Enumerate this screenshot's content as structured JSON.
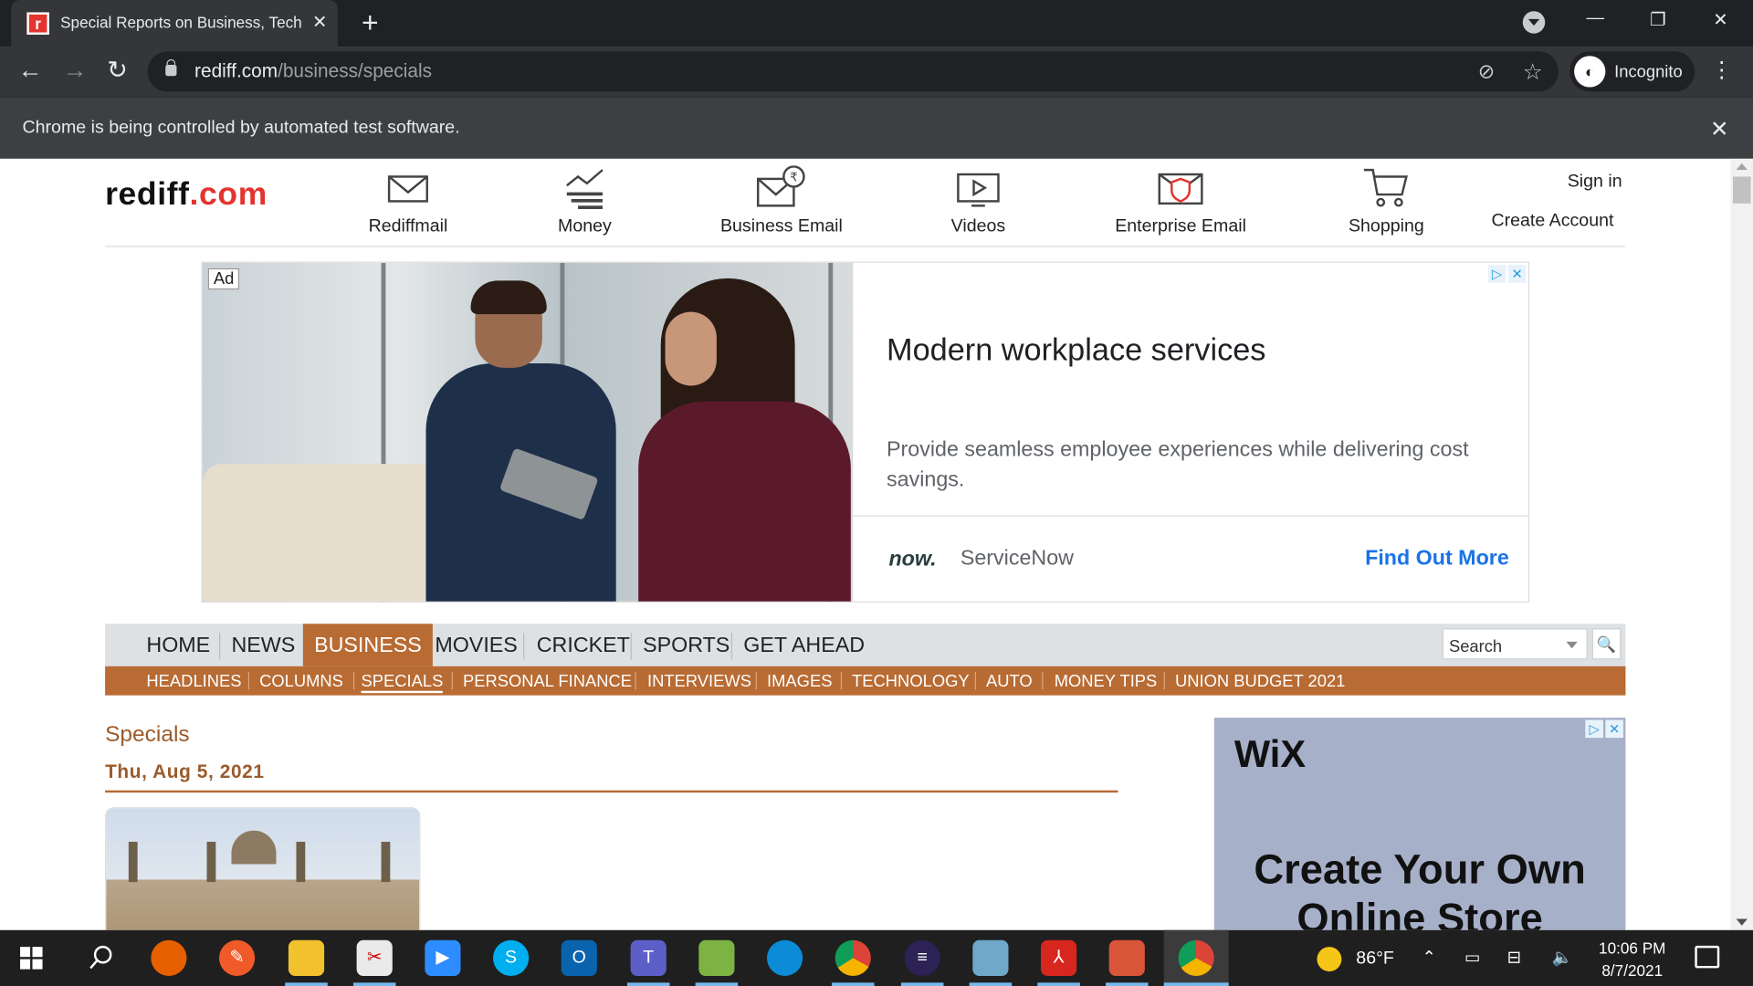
{
  "browser": {
    "tab_title": "Special Reports on Business, Tech",
    "tab_favicon": "r",
    "url_host": "rediff.com",
    "url_path": "/business/specials",
    "incognito_label": "Incognito",
    "infobar_text": "Chrome is being controlled by automated test software."
  },
  "header": {
    "logo_main": "rediff",
    "logo_dotcom": ".com",
    "nav": [
      {
        "label": "Rediffmail",
        "icon": "envelope-icon"
      },
      {
        "label": "Money",
        "icon": "chart-icon"
      },
      {
        "label": "Business Email",
        "icon": "rupee-mail-icon"
      },
      {
        "label": "Videos",
        "icon": "video-icon"
      },
      {
        "label": "Enterprise Email",
        "icon": "shield-mail-icon"
      },
      {
        "label": "Shopping",
        "icon": "cart-icon"
      }
    ],
    "sign_in": "Sign in",
    "create_account": "Create Account"
  },
  "top_ad": {
    "badge": "Ad",
    "headline": "Modern workplace services",
    "description": "Provide seamless employee experiences while delivering cost savings.",
    "brand_logo": "now.",
    "brand_name": "ServiceNow",
    "cta": "Find Out More"
  },
  "main_nav": {
    "items": [
      "HOME",
      "NEWS",
      "BUSINESS",
      "MOVIES",
      "CRICKET",
      "SPORTS",
      "GET AHEAD"
    ],
    "active": "BUSINESS",
    "search_placeholder": "Search"
  },
  "sub_nav": {
    "items": [
      "HEADLINES",
      "COLUMNS",
      "SPECIALS",
      "PERSONAL FINANCE",
      "INTERVIEWS",
      "IMAGES",
      "TECHNOLOGY",
      "AUTO",
      "MONEY TIPS",
      "UNION BUDGET 2021"
    ],
    "active": "SPECIALS"
  },
  "content": {
    "section_title": "Specials",
    "date": "Thu, Aug 5, 2021"
  },
  "side_ad": {
    "logo": "WiX",
    "headline": "Create Your Own Online Store"
  },
  "taskbar": {
    "temperature": "86°F",
    "time": "10:06 PM",
    "date": "8/7/2021"
  },
  "colors": {
    "accent": "#b86b33",
    "brand_red": "#e3342f",
    "cta_blue": "#1a73e8"
  }
}
